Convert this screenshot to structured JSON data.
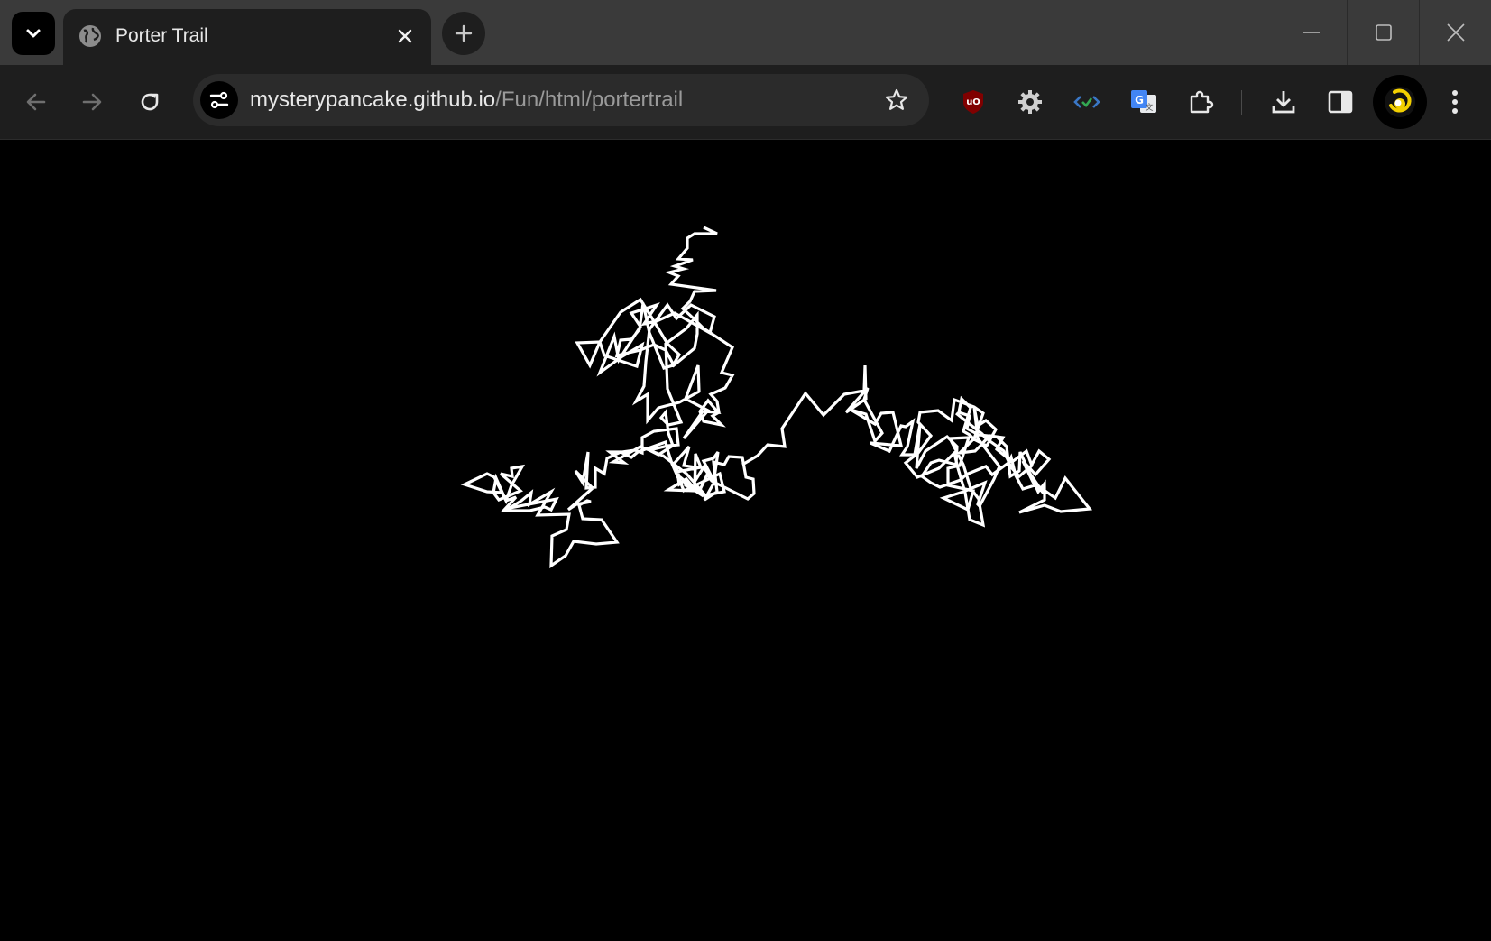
{
  "tabs": [
    {
      "title": "Porter Trail",
      "favicon": "globe-icon",
      "active": true
    }
  ],
  "address_bar": {
    "host": "mysterypancake.github.io",
    "path": "/Fun/html/portertrail"
  },
  "toolbar_icons": [
    "back-arrow-icon",
    "forward-arrow-icon",
    "reload-icon",
    "site-info-icon",
    "bookmark-star-icon",
    "ublock-origin-icon",
    "gear-extension-icon",
    "code-check-extension-icon",
    "google-translate-icon",
    "extensions-puzzle-icon",
    "download-icon",
    "side-panel-icon",
    "profile-avatar-icon",
    "kebab-menu-icon"
  ],
  "window_controls": [
    "minimize-icon",
    "maximize-icon",
    "close-icon"
  ],
  "canvas": {
    "background": "#000000",
    "stroke_color": "#ffffff"
  }
}
